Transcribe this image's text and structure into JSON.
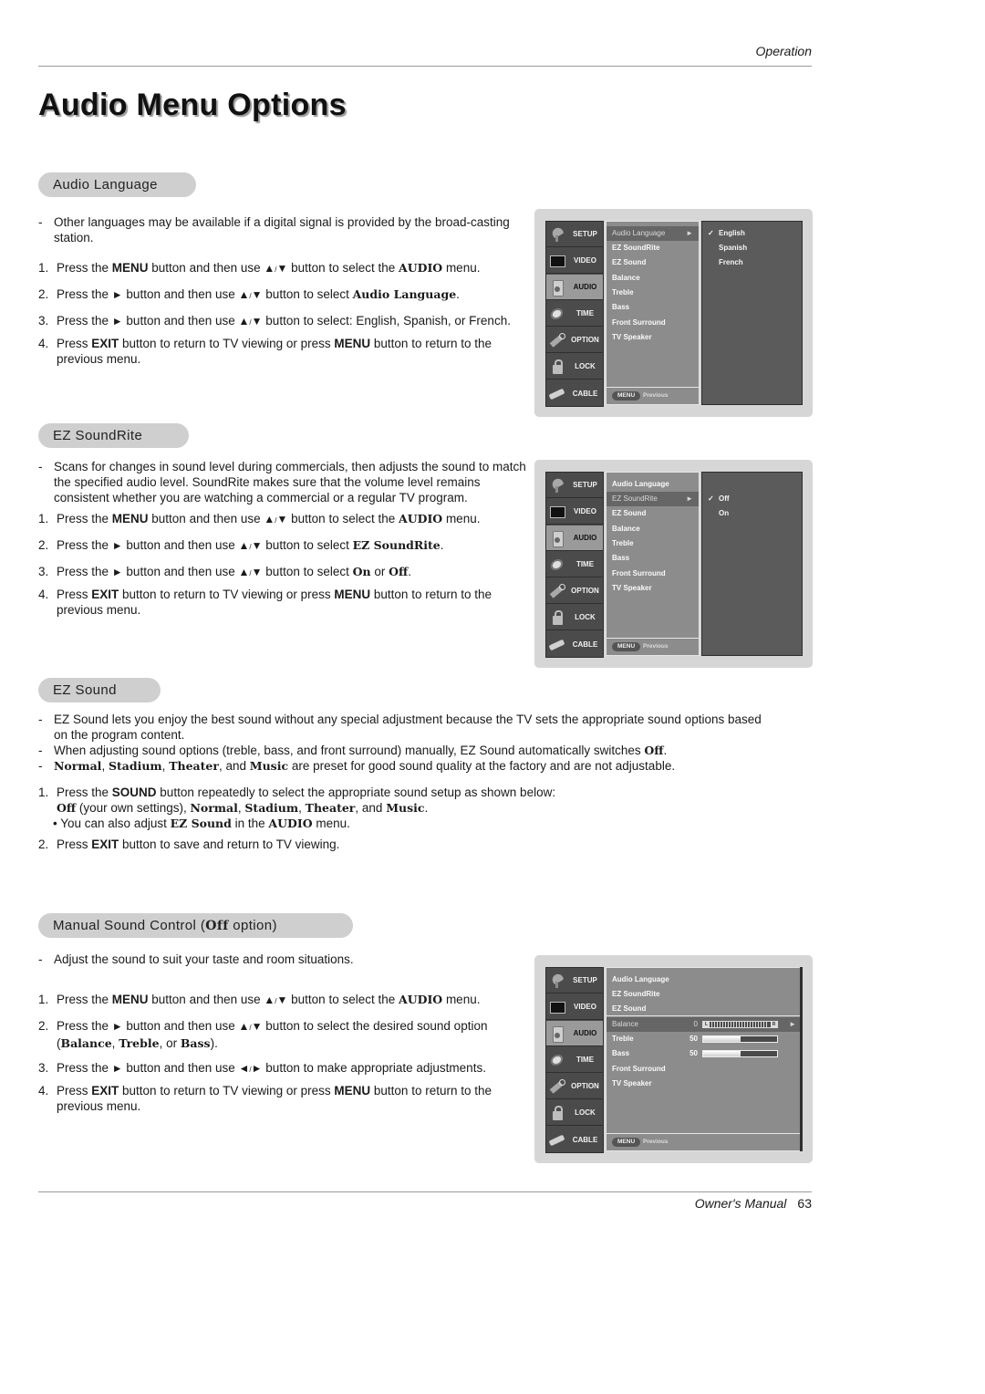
{
  "header": {
    "section": "Operation"
  },
  "page_title": "Audio Menu Options",
  "glyphs": {
    "up": "▲",
    "down": "▼",
    "right": "►",
    "left": "◄",
    "slash": "/",
    "check": "✓",
    "bullet": "•"
  },
  "sections": {
    "audio_language": {
      "heading": "Audio Language",
      "note": "Other languages may be available if a digital signal is provided by the broad-casting station.",
      "steps": [
        {
          "num": "1.",
          "a": "Press the ",
          "b1": "MENU",
          "c": " button and then use ",
          "d": " button to select the ",
          "e": "AUDIO",
          "f": " menu."
        },
        {
          "num": "2.",
          "a": "Press the ",
          "c": " button and then use ",
          "d": " button to select ",
          "e": "Audio Language",
          "f": "."
        },
        {
          "num": "3.",
          "a": "Press the ",
          "c": " button and then use ",
          "d": " button to select: English, Spanish, or French."
        },
        {
          "num": "4.",
          "a": "Press ",
          "b1": "EXIT",
          "c": " button to return to TV viewing or press ",
          "b2": "MENU",
          "d": " button to return to the previous menu."
        }
      ]
    },
    "ez_soundrite": {
      "heading": "EZ SoundRite",
      "note": "Scans for changes in sound level during commercials, then adjusts the sound to match the specified audio level. SoundRite makes sure that the volume level remains consistent whether you are watching a commercial or a regular TV program.",
      "steps": [
        {
          "num": "1.",
          "a": "Press the ",
          "b1": "MENU",
          "c": " button and then use ",
          "d": " button to select the ",
          "e": "AUDIO",
          "f": " menu."
        },
        {
          "num": "2.",
          "a": "Press the ",
          "c": " button and then use ",
          "d": " button to select ",
          "e": "EZ SoundRite",
          "f": "."
        },
        {
          "num": "3.",
          "a": "Press the ",
          "c": " button and then use ",
          "d": " button to select ",
          "e": "On",
          "f": " or ",
          "g": "Off",
          "h": "."
        },
        {
          "num": "4.",
          "a": "Press ",
          "b1": "EXIT",
          "c": " button to return to TV viewing or press ",
          "b2": "MENU",
          "d": " button to return to the previous menu."
        }
      ]
    },
    "ez_sound": {
      "heading": "EZ Sound",
      "notes": [
        "EZ Sound lets you enjoy the best sound without any special adjustment because the TV sets the appropriate sound options based on the program content.",
        {
          "a": "When adjusting sound options (treble, bass, and front surround) manually, EZ Sound automatically switches ",
          "b": "Off",
          "c": "."
        },
        {
          "p1": "Normal",
          "p2": "Stadium",
          "p3": "Theater",
          "p4": "Music",
          "comma": ", ",
          "and": ", and ",
          "rest": " are preset for good sound quality at the factory and are not adjustable."
        }
      ],
      "step1": {
        "num": "1.",
        "a": "Press the ",
        "b": "SOUND",
        "c": " button repeatedly to select the appropriate sound setup as shown below:",
        "off": "Off",
        "own": " (your own settings), ",
        "tip_a": "You can also adjust ",
        "tip_b": "EZ Sound",
        "tip_c": " in the ",
        "tip_d": "AUDIO",
        "tip_e": " menu."
      },
      "step2": {
        "num": "2.",
        "a": "Press ",
        "b": "EXIT",
        "c": " button to save and return to TV viewing."
      }
    },
    "manual_sound": {
      "heading_a": "Manual Sound Control (",
      "heading_b": "Off",
      "heading_c": " option)",
      "note": "Adjust the sound to suit your taste and room situations.",
      "steps": [
        {
          "num": "1.",
          "a": "Press the ",
          "b1": "MENU",
          "c": " button and then use ",
          "d": " button to select the ",
          "e": "AUDIO",
          "f": " menu."
        },
        {
          "num": "2.",
          "a": "Press the ",
          "c": " button and then use ",
          "d": " button to select the desired sound option (",
          "e": "Balance",
          "f": ", ",
          "g": "Treble",
          "h": ", or ",
          "i": "Bass",
          "j": ")."
        },
        {
          "num": "3.",
          "a": "Press the ",
          "c": " button and then use ",
          "d": " button to make appropriate adjustments."
        },
        {
          "num": "4.",
          "a": "Press ",
          "b1": "EXIT",
          "c": " button to return to TV viewing or press ",
          "b2": "MENU",
          "d": " button to return to the previous menu."
        }
      ]
    }
  },
  "osd": {
    "tabs": [
      "SETUP",
      "VIDEO",
      "AUDIO",
      "TIME",
      "OPTION",
      "LOCK",
      "CABLE"
    ],
    "active_tab": "AUDIO",
    "menu_items": [
      "Audio Language",
      "EZ SoundRite",
      "EZ Sound",
      "Balance",
      "Treble",
      "Bass",
      "Front Surround",
      "TV Speaker"
    ],
    "footer_key": "MENU",
    "footer_label": "Previous",
    "screen1": {
      "selected": "Audio Language",
      "options": [
        "English",
        "Spanish",
        "French"
      ],
      "checked": "English"
    },
    "screen2": {
      "selected": "EZ SoundRite",
      "options": [
        "Off",
        "On"
      ],
      "checked": "Off"
    },
    "screen3": {
      "selected": "Balance",
      "balance": {
        "value": "0",
        "left": "L",
        "right": "R"
      },
      "treble": {
        "value": "50",
        "level": 0.5
      },
      "bass": {
        "value": "50",
        "level": 0.5
      }
    }
  },
  "footer": {
    "label": "Owner's Manual",
    "page": "63"
  }
}
